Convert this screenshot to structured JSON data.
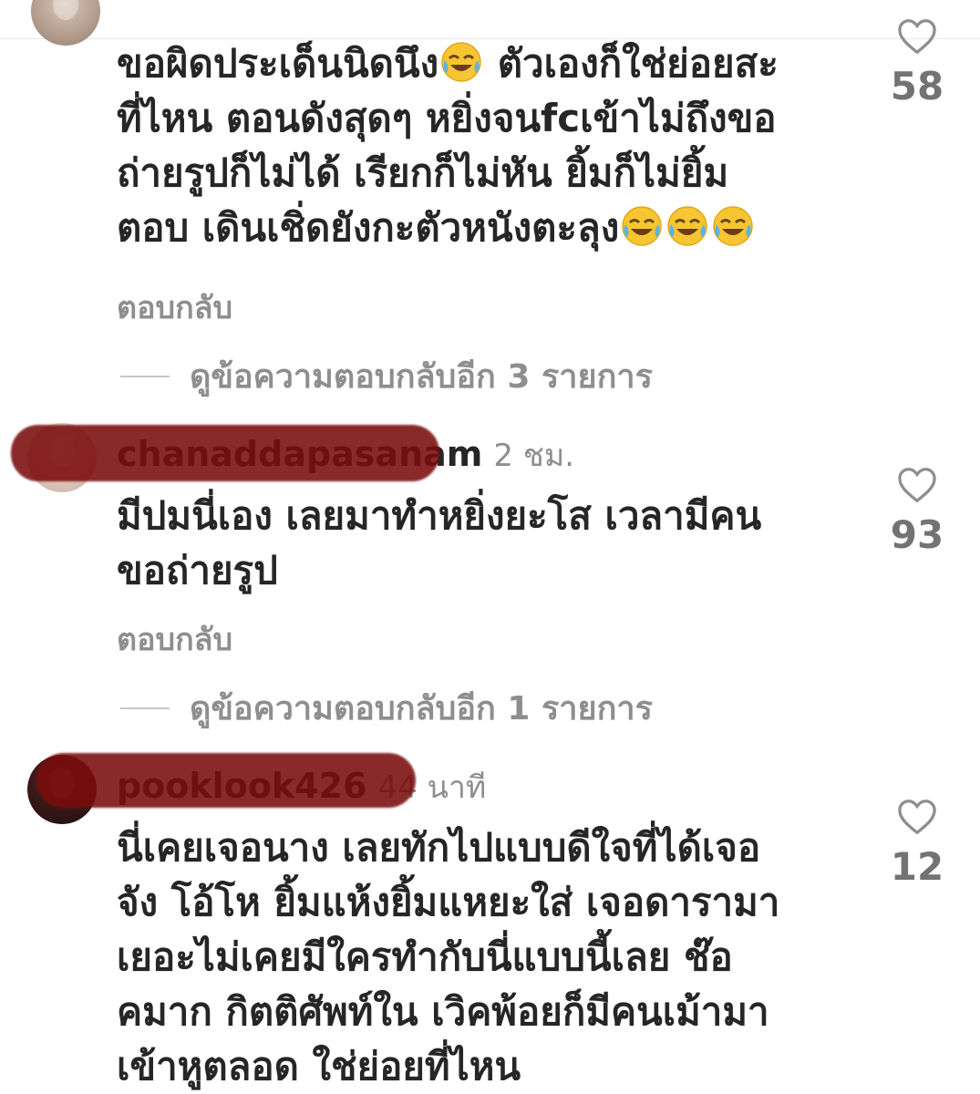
{
  "comments": [
    {
      "username": "",
      "timestamp": "",
      "text_lines": [
        "ขอผิดประเด็นนิดนึง",
        "ตัวเองก็ใช่ย่อยสะ",
        "ที่ไหน ตอนดังสุดๆ หยิ่งจนfcเข้าไม่ถึงขอ",
        "ถ่ายรูปก็ไม่ได้ เรียกก็ไม่หัน ยิ้มก็ไม่ยิ้ม",
        "ตอบ เดินเชิ่ดยังกะตัวหนังตะลุง"
      ],
      "emoji_icon": "face-with-tears-of-joy-icon",
      "reply_label": "ตอบกลับ",
      "view_replies": "ดูข้อความตอบกลับอีก 3 รายการ",
      "likes": "58"
    },
    {
      "username": "chanaddapasanam",
      "timestamp": "2 ชม.",
      "text_lines": [
        "มีปมนี่เอง เลยมาทำหยิ่งยะโส เวลามีคน",
        "ขอถ่ายรูป"
      ],
      "reply_label": "ตอบกลับ",
      "view_replies": "ดูข้อความตอบกลับอีก 1 รายการ",
      "likes": "93"
    },
    {
      "username": "pooklook426",
      "timestamp": "44 นาที",
      "text_lines": [
        "นี่เคยเจอนาง เลยทักไปแบบดีใจที่ได้เจอ",
        "จัง โอ้โห ยิ้มแห้งยิ้มแหยะใส่ เจอดารามา",
        "เยอะไม่เคยมีใครทำกับนี่แบบนี้เลย ช๊อ",
        "คมาก  กิตติศัพท์ใน เวิคพ้อยก็มีคนเม้ามา",
        "เข้าหูตลอด ใช่ย่อยที่ไหน"
      ],
      "likes": "12"
    }
  ],
  "colors": {
    "text": "#262626",
    "secondary": "#8e8e8e",
    "redaction": "#7a0c0c"
  }
}
